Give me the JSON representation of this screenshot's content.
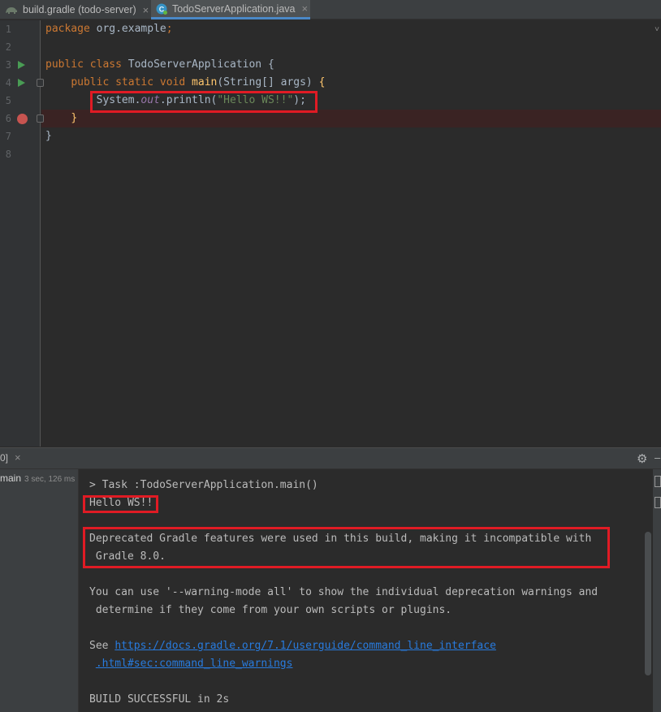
{
  "tabs": [
    {
      "label": "build.gradle (todo-server)",
      "close": "×",
      "active": false,
      "icon": "gradle-elephant-icon"
    },
    {
      "label": "TodoServerApplication.java",
      "close": "×",
      "active": true,
      "icon": "java-class-icon"
    }
  ],
  "editor": {
    "line_numbers": [
      "1",
      "2",
      "3",
      "4",
      "5",
      "6",
      "7",
      "8"
    ],
    "lines": [
      {
        "n": "1",
        "code": "package org.example;"
      },
      {
        "n": "2",
        "code": ""
      },
      {
        "n": "3",
        "code": "public class TodoServerApplication {"
      },
      {
        "n": "4",
        "code": "    public static void main(String[] args) {"
      },
      {
        "n": "5",
        "code": "        System.out.println(\"Hello WS!!\");"
      },
      {
        "n": "6",
        "code": "    }"
      },
      {
        "n": "7",
        "code": "}"
      },
      {
        "n": "8",
        "code": ""
      }
    ],
    "tokens": {
      "package_kw": "package",
      "package_name": " org.example",
      "semicolon": ";",
      "public_kw": "public",
      "class_kw": "class",
      "class_name": " TodoServerApplication {",
      "static_kw": "static",
      "void_kw": "void",
      "main_name": "main",
      "main_params": "(String[] args) ",
      "brace_open": "{",
      "system": "System.",
      "out": "out",
      "println": ".println(",
      "string": "\"Hello WS!!\"",
      "close_paren": ");",
      "brace_close_inner": "}",
      "brace_close_outer": "}"
    },
    "colors": {
      "keyword": "#cc7832",
      "string": "#6a8759",
      "method": "#ffc66d",
      "field": "#9876aa",
      "breakpoint": "#c75450",
      "highlight_box": "#e01b24"
    }
  },
  "run_panel": {
    "tab_label": "0]",
    "tab_close": "×",
    "tree_item": "main",
    "tree_time": "3 sec, 126 ms",
    "gear": "⚙",
    "minimize": "–"
  },
  "console": {
    "lines": [
      "> Task :TodoServerApplication.main()",
      "Hello WS!!",
      "",
      "Deprecated Gradle features were used in this build, making it incompatible with",
      " Gradle 8.0.",
      "",
      "You can use '--warning-mode all' to show the individual deprecation warnings and",
      " determine if they come from your own scripts or plugins.",
      "",
      "See ",
      "",
      "",
      "BUILD SUCCESSFUL in 2s"
    ],
    "see_prefix": "See ",
    "link_part1": "https://docs.gradle.org/7.1/userguide/command_line_interface",
    "link_part2": ".html#sec:command_line_warnings",
    "link_indent": " "
  }
}
